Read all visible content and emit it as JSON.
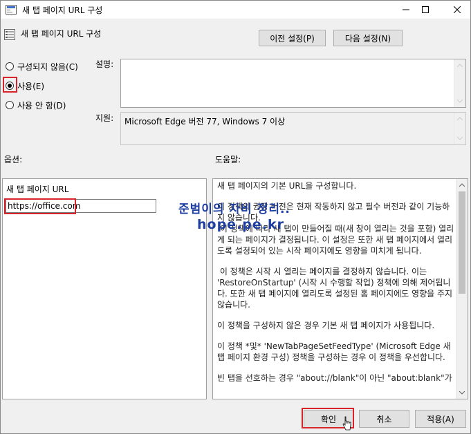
{
  "titlebar": {
    "title": "새 탭 페이지 URL 구성"
  },
  "header": {
    "title": "새 탭 페이지 URL 구성",
    "prev_button": "이전 설정(P)",
    "next_button": "다음 설정(N)"
  },
  "options": {
    "not_configured": "구성되지 않음(C)",
    "enabled": "사용(E)",
    "disabled": "사용 안 함(D)",
    "selected": "enabled"
  },
  "comment": {
    "label": "설명:",
    "value": ""
  },
  "supported": {
    "label": "지원:",
    "value": "Microsoft Edge 버전 77, Windows 7 이상"
  },
  "options_section": {
    "label": "옵션:",
    "field_label": "새 탭 페이지 URL",
    "field_value": "https://office.com"
  },
  "help_section": {
    "label": "도움말:",
    "paragraphs": [
      "새 탭 페이지의 기본 URL을 구성합니다.",
      "이 정책의 권장 버전은 현재 작동하지 않고 필수 버전과 같이 기능하지 않습니다.",
      " 이 정책에 따라 새 탭이 만들어질 때(새 창이 열리는 것을 포함) 열리게 되는 페이지가 결정됩니다. 이 설정은 또한 새 탭 페이지에서 열리도록 설정되어 있는 시작 페이지에도 영향을 미치게 됩니다.",
      " 이 정책은 시작 시 열리는 페이지를 결정하지 않습니다. 이는 'RestoreOnStartup' (시작 시 수행할 작업) 정책에 의해 제어됩니다. 또한 새 탭 페이지에 열리도록 설정된 홈 페이지에도 영향을 주지 않습니다.",
      "이 정책을 구성하지 않은 경우 기본 새 탭 페이지가 사용됩니다.",
      "이 정책 *및* 'NewTabPageSetFeedType' (Microsoft Edge 새 탭 페이지 환경 구성) 정책을 구성하는 경우 이 정책을 우선합니다.",
      "빈 탭을 선호하는 경우 \"about://blank\"이 아닌 \"about:blank\"가"
    ]
  },
  "footer": {
    "ok": "확인",
    "cancel": "취소",
    "apply": "적용(A)"
  },
  "watermark": {
    "line1": "준범이의 자비 정리..",
    "line2": "hope.pe.kr"
  },
  "colors": {
    "highlight": "#d9232b",
    "watermark": "#1f3fa0"
  }
}
